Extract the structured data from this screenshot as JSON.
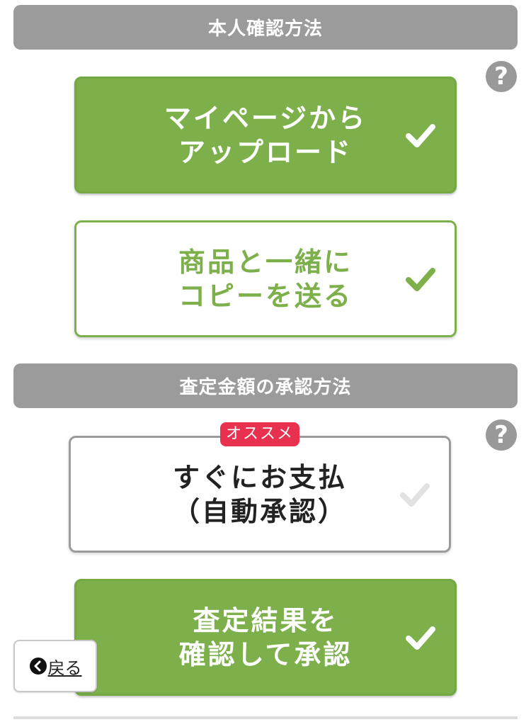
{
  "identity_section": {
    "title": "本人確認方法",
    "help_icon": "question-circle-icon",
    "options": [
      {
        "line1": "マイページから",
        "line2": "アップロード",
        "selected": true
      },
      {
        "line1": "商品と一緒に",
        "line2": "コピーを送る",
        "selected": false
      }
    ]
  },
  "approval_section": {
    "title": "査定金額の承認方法",
    "help_icon": "question-circle-icon",
    "badge": "オススメ",
    "options": [
      {
        "line1": "すぐにお支払",
        "line2": "（自動承認）",
        "selected": false
      },
      {
        "line1": "査定結果を",
        "line2": "確認して承認",
        "selected": true
      }
    ]
  },
  "back_button": {
    "label": "戻る",
    "icon": "chevron-left-circle-icon"
  },
  "colors": {
    "accent_green": "#7db04b",
    "header_gray": "#9b9b9b",
    "badge_red": "#e8304f"
  }
}
